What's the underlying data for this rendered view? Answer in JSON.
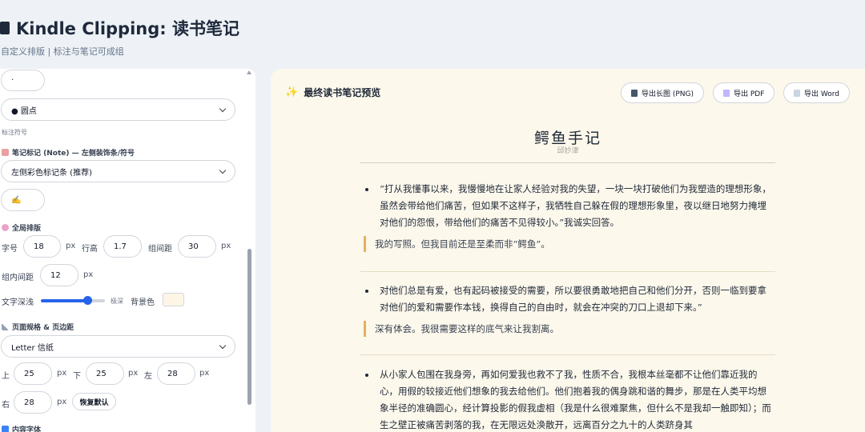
{
  "header": {
    "title": "Kindle Clipping: 读书笔记",
    "subtitle": "自定义排版 | 标注与笔记可成组"
  },
  "sidebar": {
    "marker_char_value": "·",
    "bullet_style_select": "● 圆点",
    "annotation_symbol_label": "标注符号",
    "note_section_title": "笔记标记 (Note) — 左侧装饰条/符号",
    "note_style_select": "左侧彩色标记条 (推荐)",
    "note_symbol_value": "✍️",
    "global_layout_title": "全局排版",
    "font_size_label": "字号",
    "font_size_value": "18",
    "line_height_label": "行高",
    "line_height_value": "1.7",
    "group_spacing_label": "组间距",
    "group_spacing_value": "30",
    "inner_spacing_label": "组内间距",
    "inner_spacing_value": "12",
    "unit_px": "px",
    "text_depth_label": "文字深浅",
    "text_depth_level": 0.72,
    "text_depth_end_label": "极深",
    "bg_color_label": "背景色",
    "bg_color_value": "#fdf6e7",
    "page_section_title": "页面规格 & 页边距",
    "page_size_select": "Letter 信纸",
    "margin_top_label": "上",
    "margin_top_value": "25",
    "margin_bottom_label": "下",
    "margin_bottom_value": "25",
    "margin_left_label": "左",
    "margin_left_value": "28",
    "margin_right_label": "右",
    "margin_right_value": "28",
    "reset_button": "恢复默认",
    "content_font_title": "内容字体"
  },
  "preview": {
    "heading": "最终读书笔记预览",
    "export_png": "导出长图 (PNG)",
    "export_pdf": "导出 PDF",
    "export_word": "导出 Word",
    "book_title": "鳄鱼手记",
    "author": "邱妙津",
    "entries": [
      {
        "quote": "“打从我懂事以来，我慢慢地在让家人经验对我的失望，一块一块打破他们为我塑造的理想形象，虽然会带给他们痛苦，但如果不这样子，我牺牲自己躲在假的理想形象里，夜以继日地努力掩埋对他们的怨恨，带给他们的痛苦不见得较小。”我诚实回答。",
        "note": "我的写照。但我目前还是至柔而非“鳄鱼”。"
      },
      {
        "quote": "对他们总是有爱，也有起码被接受的需要，所以要很勇敢地把自己和他们分开，否则一临到要拿对他们的爱和需要作本钱，换得自己的自由时，就会在冲突的刀口上退却下来。”",
        "note": "深有体会。我很需要这样的底气来让我割离。"
      },
      {
        "quote": "从小家人包围在我身旁，再如何爱我也救不了我，性质不合，我根本丝毫都不让他们靠近我的心，用假的较接近他们想象的我去给他们。他们抱着我的偶身跳和谐的舞步，那是在人类平均想象半径的准确圆心，经计算投影的假我虚相（我是什么很难聚焦，但什么不是我却一触即知）；而生之壁正被痛苦剥落的我，在无限远处涣散开，远离百分之九十的人类跻身其",
        "note": ""
      }
    ]
  },
  "colors": {
    "accent": "#2563eb",
    "note_bar": "#e3b25a",
    "page_bg": "#fdf8ec"
  }
}
